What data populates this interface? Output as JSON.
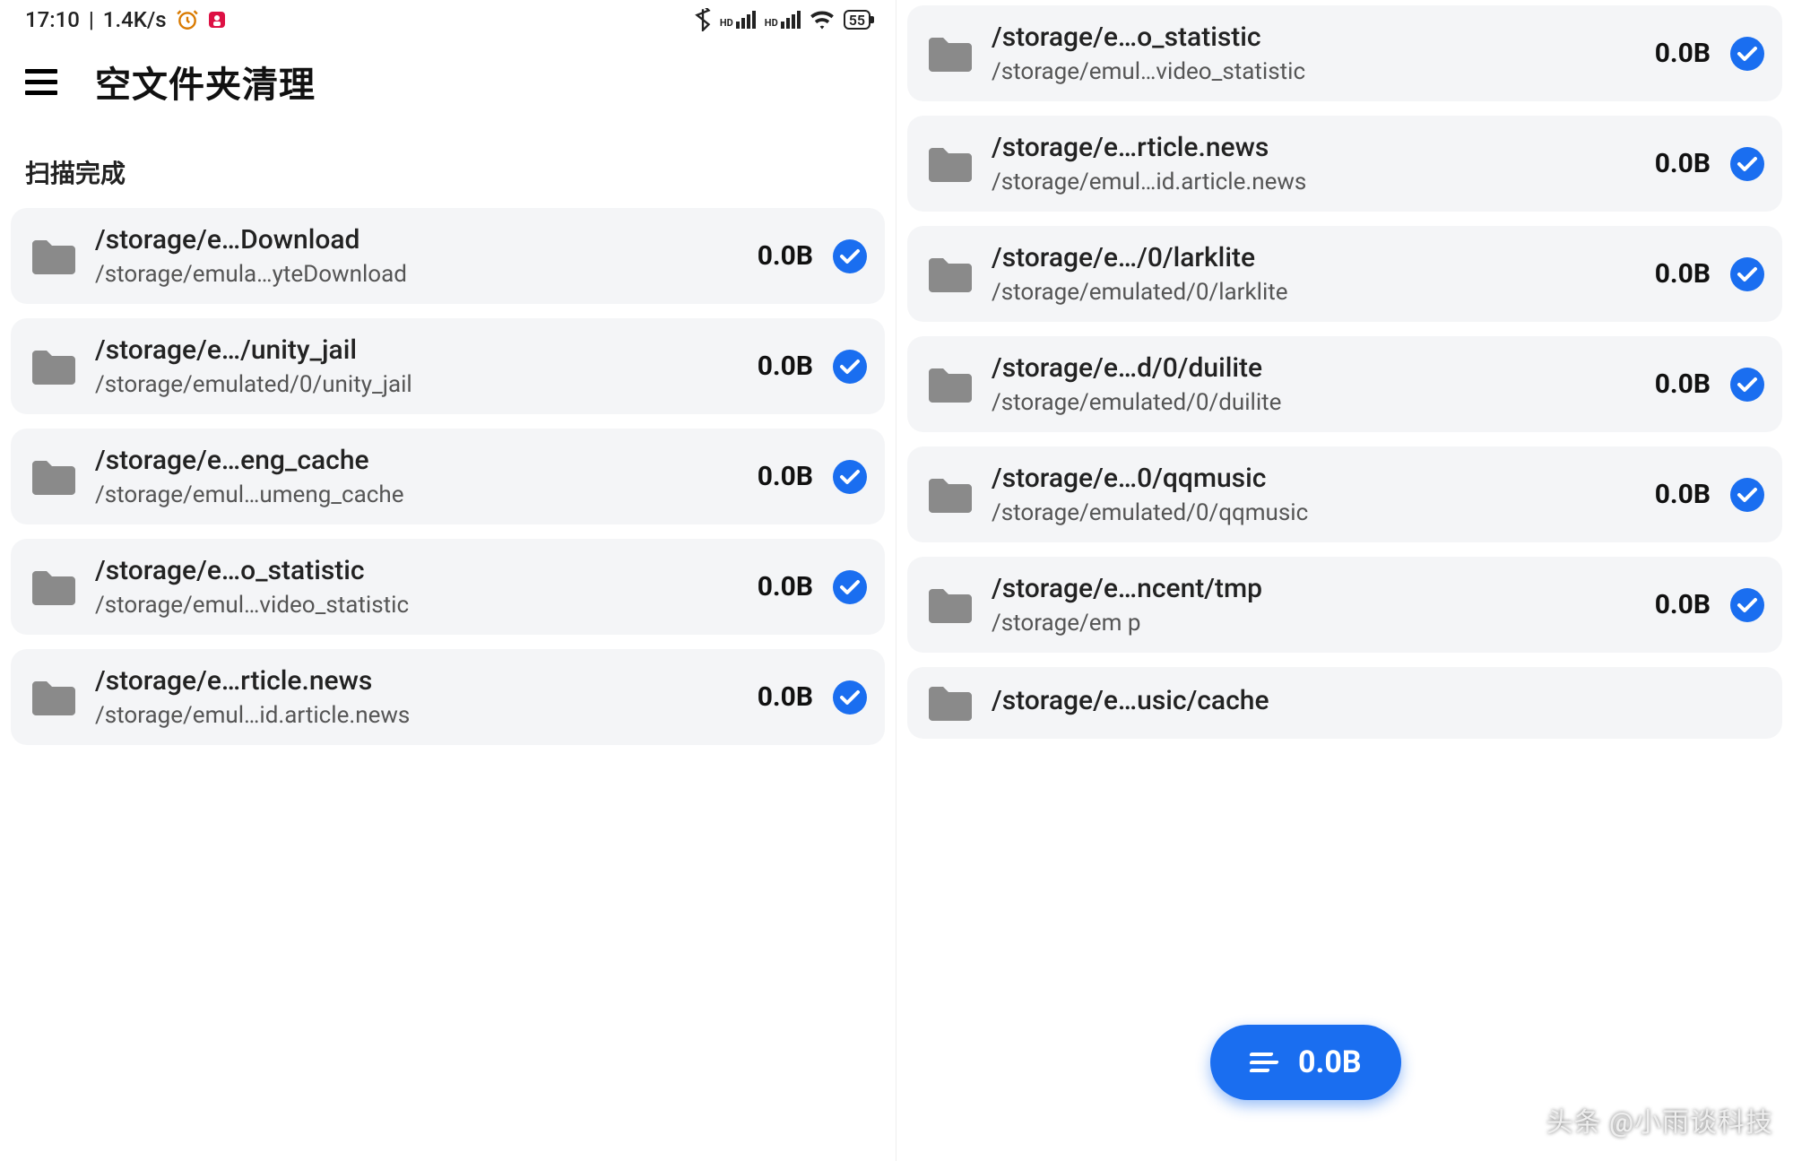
{
  "status_bar": {
    "time": "17:10",
    "speed": "1.4K/s",
    "battery": "55"
  },
  "header": {
    "title": "空文件夹清理"
  },
  "scan_status": "扫描完成",
  "fab": {
    "label": "0.0B"
  },
  "watermark": "头条 @小雨谈科技",
  "left_items": [
    {
      "title": "/storage/e…Download",
      "path": "/storage/emula…yteDownload",
      "size": "0.0B"
    },
    {
      "title": "/storage/e…/unity_jail",
      "path": "/storage/emulated/0/unity_jail",
      "size": "0.0B"
    },
    {
      "title": "/storage/e…eng_cache",
      "path": "/storage/emul…umeng_cache",
      "size": "0.0B"
    },
    {
      "title": "/storage/e…o_statistic",
      "path": "/storage/emul…video_statistic",
      "size": "0.0B"
    },
    {
      "title": "/storage/e…rticle.news",
      "path": "/storage/emul…id.article.news",
      "size": "0.0B"
    }
  ],
  "right_items": [
    {
      "title": "/storage/e…o_statistic",
      "path": "/storage/emul…video_statistic",
      "size": "0.0B"
    },
    {
      "title": "/storage/e…rticle.news",
      "path": "/storage/emul…id.article.news",
      "size": "0.0B"
    },
    {
      "title": "/storage/e…/0/larklite",
      "path": "/storage/emulated/0/larklite",
      "size": "0.0B"
    },
    {
      "title": "/storage/e…d/0/duilite",
      "path": "/storage/emulated/0/duilite",
      "size": "0.0B"
    },
    {
      "title": "/storage/e…0/qqmusic",
      "path": "/storage/emulated/0/qqmusic",
      "size": "0.0B"
    },
    {
      "title": "/storage/e…ncent/tmp",
      "path": "/storage/em                          p",
      "size": "0.0B"
    },
    {
      "title": "/storage/e…usic/cache",
      "path": "",
      "size": ""
    }
  ]
}
